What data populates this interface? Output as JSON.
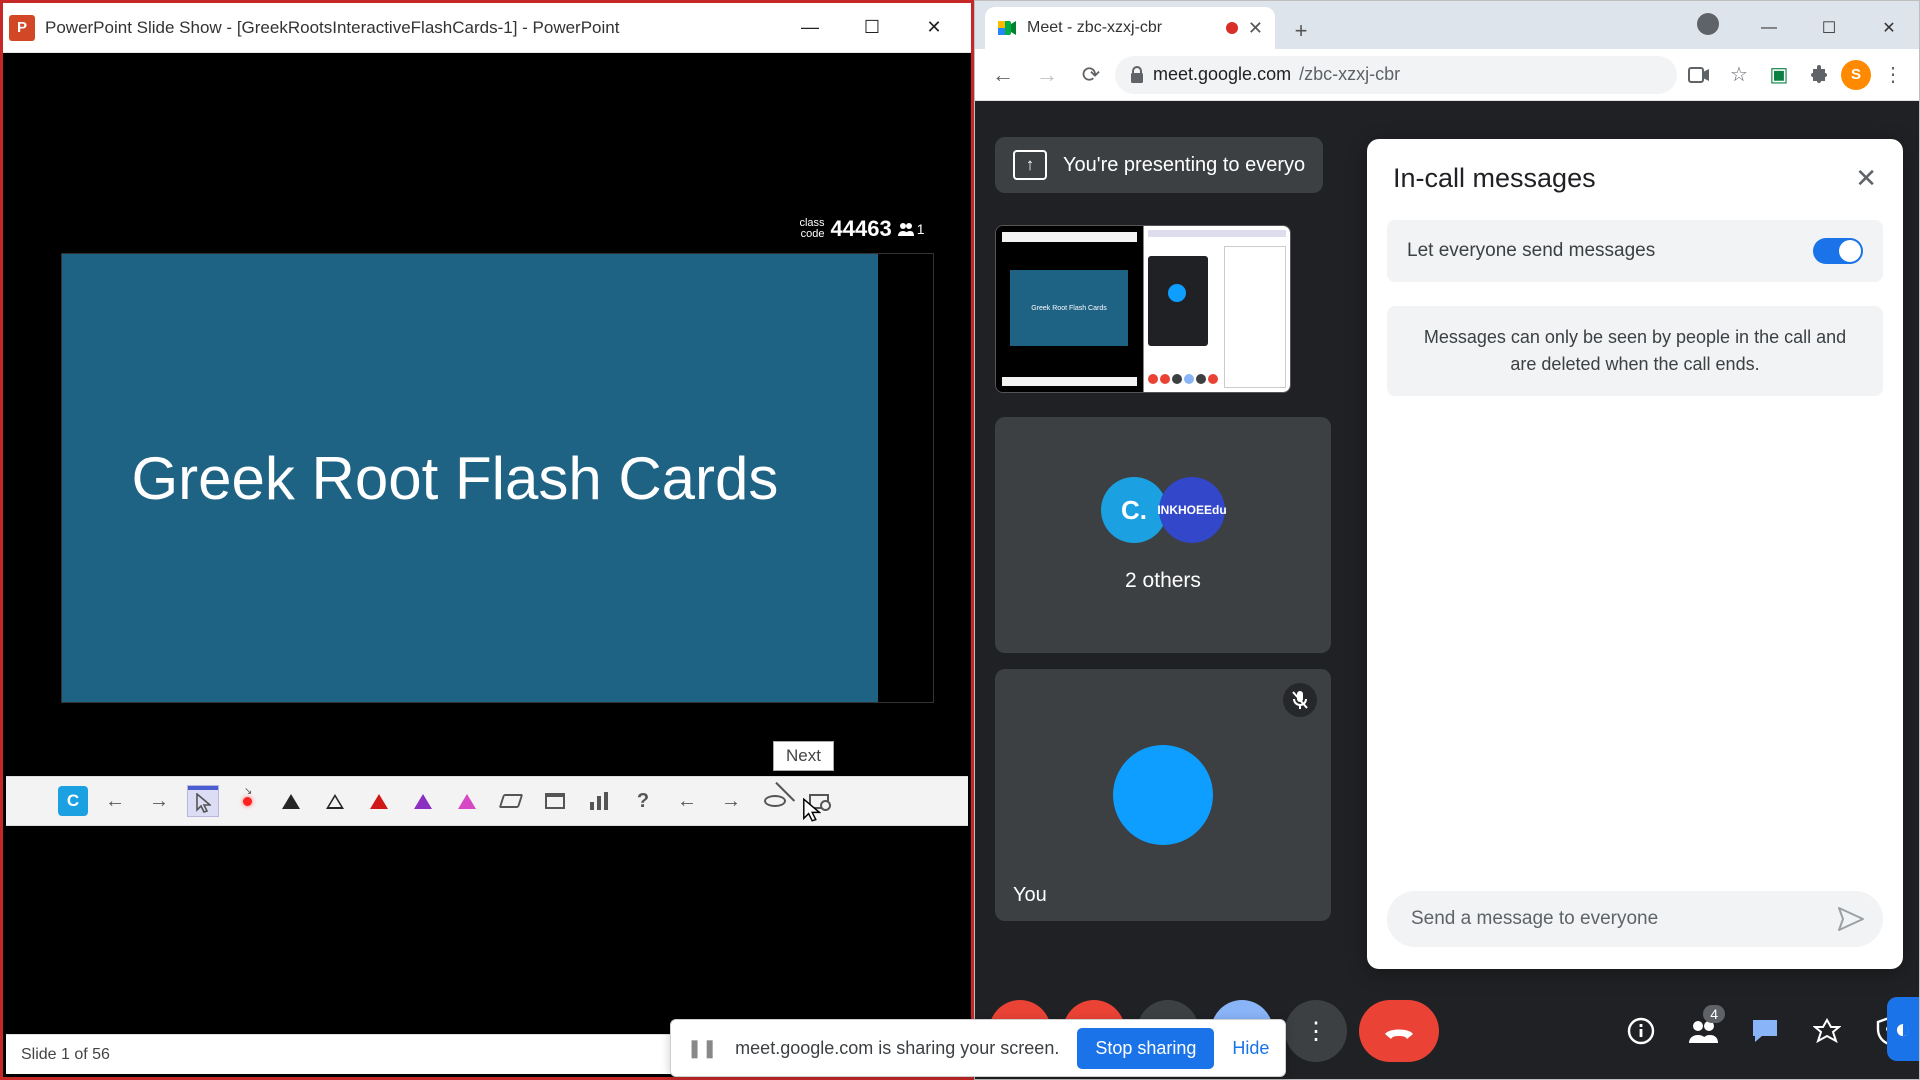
{
  "powerpoint": {
    "title": "PowerPoint Slide Show - [GreekRootsInteractiveFlashCards-1] - PowerPoint",
    "slide_title": "Greek Root Flash Cards",
    "classcode_label_top": "class",
    "classcode_label_bot": "code",
    "classcode_value": "44463",
    "classcode_people": "1",
    "tooltip_next": "Next",
    "status_text": "Slide 1 of 56",
    "thumb_slide_text": "Greek Root Flash Cards"
  },
  "chrome": {
    "tab_title": "Meet - zbc-xzxj-cbr",
    "url_host": "meet.google.com",
    "url_path": "/zbc-xzxj-cbr",
    "avatar_letter": "S"
  },
  "meet": {
    "presenting_text": "You're presenting to everyo",
    "others_label": "2 others",
    "you_label": "You",
    "chat_title": "In-call messages",
    "toggle_label": "Let everyone send messages",
    "info_text": "Messages can only be seen by people in the call and are deleted when the call ends.",
    "input_placeholder": "Send a message to everyone",
    "participants_badge": "4",
    "inkhoe_top": "INKHOE",
    "inkhoe_bot": "Edu"
  },
  "sharebar": {
    "text": "meet.google.com is sharing your screen.",
    "stop": "Stop sharing",
    "hide": "Hide"
  }
}
